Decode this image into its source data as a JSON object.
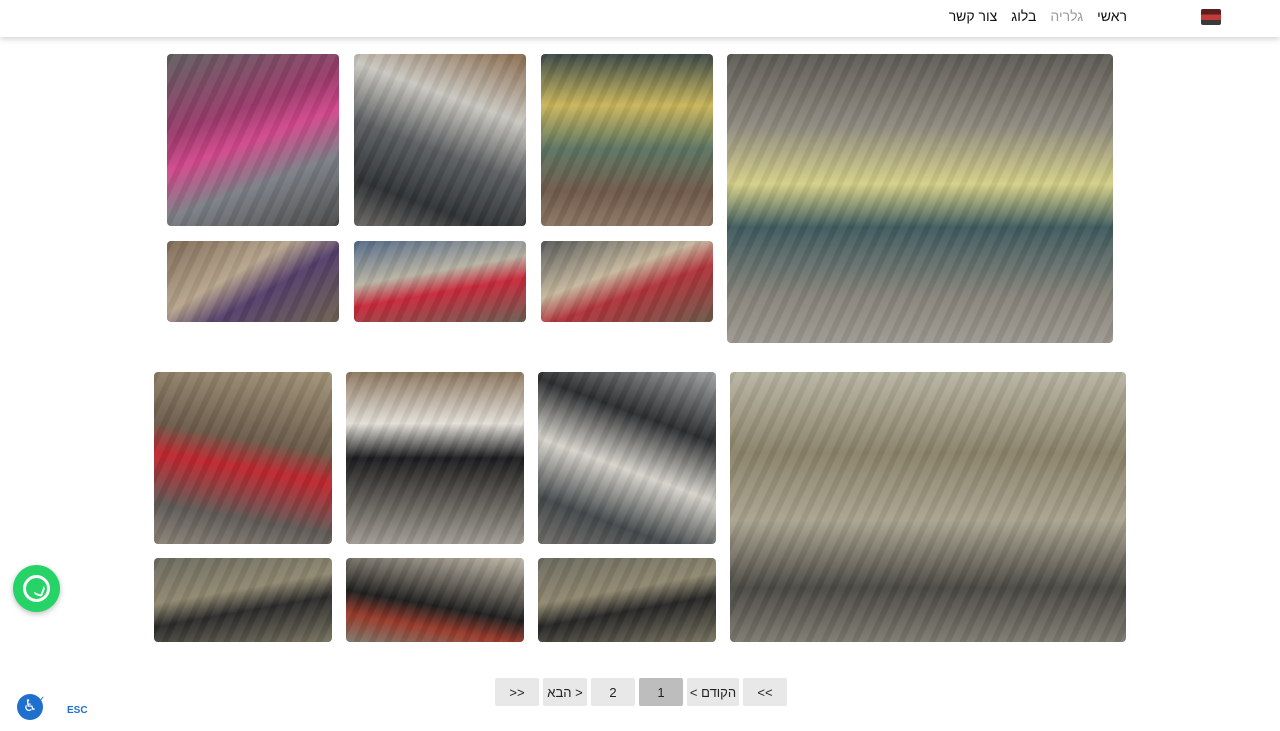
{
  "nav": {
    "items": [
      {
        "label": "ראשי",
        "active": false
      },
      {
        "label": "גלריה",
        "active": true
      },
      {
        "label": "בלוג",
        "active": false
      },
      {
        "label": "צור קשר",
        "active": false
      }
    ],
    "logo_icon": "site-logo-icon",
    "active_color": "#9a9a9a"
  },
  "gallery": {
    "blocks": [
      {
        "photos": 7
      },
      {
        "photos": 7
      }
    ]
  },
  "pagination": {
    "first_label": "<<",
    "prev_label": "< הקודם",
    "pages": [
      "1",
      "2"
    ],
    "current_page": "1",
    "next_label": "הבא >",
    "last_label": ">>"
  },
  "widgets": {
    "whatsapp_icon": "whatsapp-icon",
    "whatsapp_color": "#25d366",
    "accessibility_icon": "accessibility-icon",
    "accessibility_color": "#1f6fcf",
    "esc_label": "ESC"
  }
}
